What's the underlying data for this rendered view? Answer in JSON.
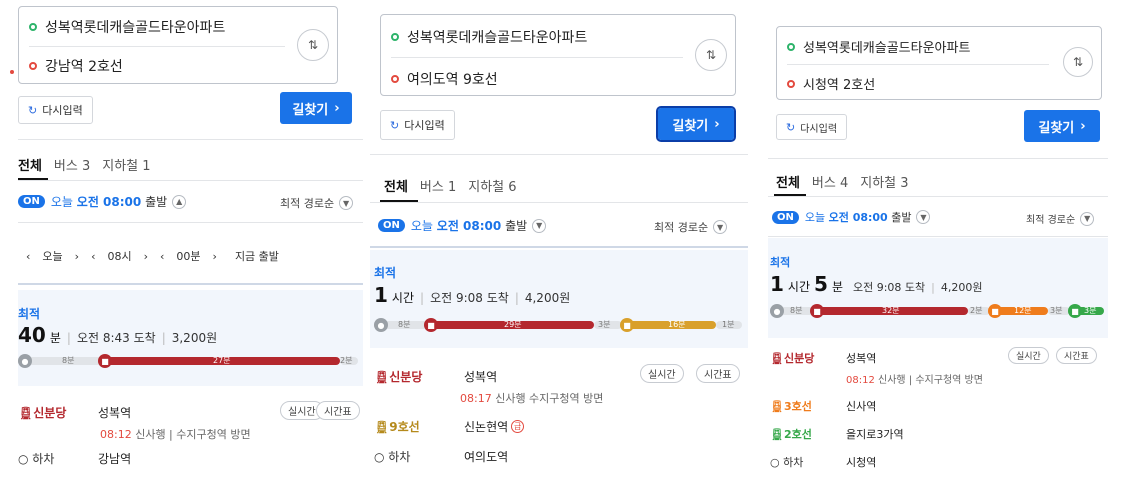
{
  "colors": {
    "accent": "#1a73e8",
    "line_sinbundang": "#b4282e",
    "line_9": "#d9a02b",
    "line_3": "#ef7c1c",
    "line_2": "#36a84a"
  },
  "common": {
    "origin": "성복역롯데캐슬골드타운아파트",
    "reset_label": "다시입력",
    "go_label": "길찾기",
    "go_chevron": "›",
    "swap_icon": "⇅",
    "tab_all": "전체",
    "on_label": "ON",
    "today": "오늘",
    "time_am": "오전 08:00",
    "depart": "출발",
    "sort_label": "최적 경로순",
    "best": "최적",
    "alight": "하차",
    "realtime": "실시간",
    "timetable": "시간표"
  },
  "panel1": {
    "destination": "강남역 2호선",
    "tab_bus": "버스 3",
    "tab_subway": "지하철 1",
    "time_nav": {
      "day": "오늘",
      "hour": "08시",
      "minute": "00분",
      "now": "지금 출발"
    },
    "summary": {
      "minutes": "40",
      "min_unit": "분",
      "arrive": "오전 8:43 도착",
      "fare": "3,200원"
    },
    "bar": {
      "walk1": "8분",
      "ride": "27분",
      "walk2": "2분"
    },
    "steps": [
      {
        "line": "신분당",
        "station": "성복역"
      },
      {
        "line": "하차",
        "station": "강남역"
      }
    ],
    "detail": {
      "time": "08:12",
      "text": "신사행 | 수지구청역 방면"
    }
  },
  "panel2": {
    "destination": "여의도역 9호선",
    "tab_bus": "버스 1",
    "tab_subway": "지하철 6",
    "summary": {
      "hours": "1",
      "hour_unit": "시간",
      "arrive": "오전 9:08 도착",
      "fare": "4,200원"
    },
    "bar": {
      "walk1": "8분",
      "ride1": "29분",
      "walk2": "3분",
      "ride2": "16분",
      "walk3": "1분"
    },
    "steps": [
      {
        "line": "신분당",
        "station": "성복역"
      },
      {
        "line": "9호선",
        "station": "신논현역"
      },
      {
        "line": "하차",
        "station": "여의도역"
      }
    ],
    "express": "급",
    "detail": {
      "time": "08:17",
      "text": "신사행 수지구청역 방면"
    }
  },
  "panel3": {
    "destination": "시청역 2호선",
    "tab_bus": "버스 4",
    "tab_subway": "지하철 3",
    "summary": {
      "hours": "1",
      "hour_unit": "시간",
      "minutes": "5",
      "min_unit": "분",
      "arrive": "오전 9:08 도착",
      "fare": "4,200원"
    },
    "bar": {
      "walk1": "8분",
      "ride1": "32분",
      "walk2": "2분",
      "ride2": "12분",
      "walk3": "3분",
      "ride3": "3분"
    },
    "steps": [
      {
        "line": "신분당",
        "station": "성복역"
      },
      {
        "line": "3호선",
        "station": "신사역"
      },
      {
        "line": "2호선",
        "station": "을지로3가역"
      },
      {
        "line": "하차",
        "station": "시청역"
      }
    ],
    "detail": {
      "time": "08:12",
      "text": "신사행 | 수지구청역 방면"
    }
  }
}
